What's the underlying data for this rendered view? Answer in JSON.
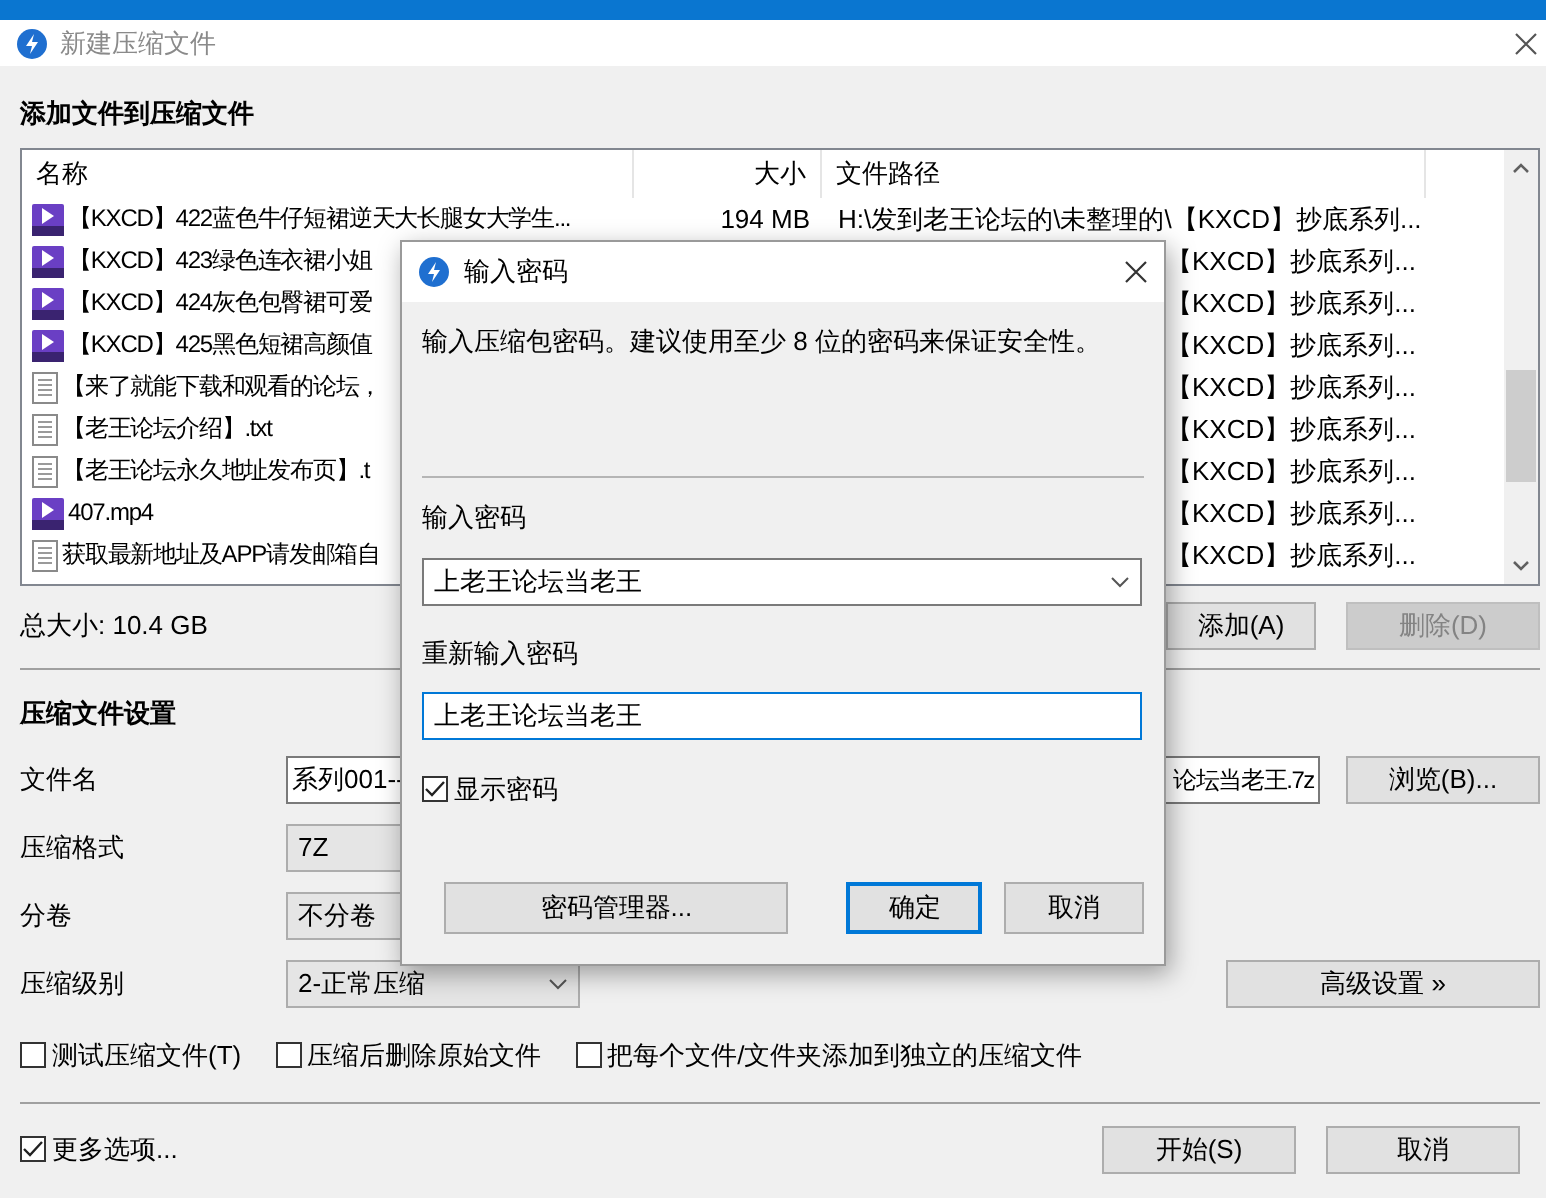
{
  "window": {
    "title": "新建压缩文件"
  },
  "files_section": {
    "heading": "添加文件到压缩文件",
    "columns": [
      "名称",
      "大小",
      "文件路径"
    ],
    "rows": [
      {
        "kind": "video",
        "name": "【KXCD】422蓝色牛仔短裙逆天大长腿女大学生...",
        "size": "194 MB",
        "path": "H:\\发到老王论坛的\\未整理的\\【KXCD】抄底系列..."
      },
      {
        "kind": "video",
        "name": "【KXCD】423绿色连衣裙小姐",
        "path": "【KXCD】抄底系列..."
      },
      {
        "kind": "video",
        "name": "【KXCD】424灰色包臀裙可爱",
        "path": "【KXCD】抄底系列..."
      },
      {
        "kind": "video",
        "name": "【KXCD】425黑色短裙高颜值",
        "path": "【KXCD】抄底系列..."
      },
      {
        "kind": "text",
        "name": "【来了就能下载和观看的论坛，",
        "path": "【KXCD】抄底系列..."
      },
      {
        "kind": "text",
        "name": "【老王论坛介绍】.txt",
        "path": "【KXCD】抄底系列..."
      },
      {
        "kind": "text",
        "name": "【老王论坛永久地址发布页】.t",
        "path": "【KXCD】抄底系列..."
      },
      {
        "kind": "video",
        "name": "407.mp4",
        "path": "【KXCD】抄底系列..."
      },
      {
        "kind": "text",
        "name": "获取最新地址及APP请发邮箱自",
        "path": "【KXCD】抄底系列..."
      }
    ],
    "total_size": "总大小: 10.4 GB",
    "buttons": [
      {
        "label": "添加(A)",
        "disabled": false
      },
      {
        "label": "删除(D)",
        "disabled": true
      }
    ]
  },
  "settings": {
    "heading": "压缩文件设置",
    "fields": [
      {
        "kind": "text",
        "label": "文件名",
        "value_start": "系列001--",
        "value_end": "论坛当老王.7z",
        "button": "浏览(B)..."
      },
      {
        "kind": "combo",
        "label": "压缩格式",
        "value": "7Z"
      },
      {
        "kind": "combo",
        "label": "分卷",
        "value": "不分卷"
      },
      {
        "kind": "combo",
        "label": "压缩级别",
        "value": "2-正常压缩",
        "button": "高级设置 »"
      }
    ],
    "options": [
      {
        "label": "测试压缩文件(T)",
        "checked": false
      },
      {
        "label": "压缩后删除原始文件",
        "checked": false
      },
      {
        "label": "把每个文件/文件夹添加到独立的压缩文件",
        "checked": false
      }
    ],
    "more_options": {
      "label": "更多选项...",
      "checked": true
    },
    "buttons": [
      "开始(S)",
      "取消"
    ]
  },
  "password_dialog": {
    "title": "输入密码",
    "message": "输入压缩包密码。建议使用至少 8 位的密码来保证安全性。",
    "password_label": "输入密码",
    "password": "上老王论坛当老王",
    "confirm_label": "重新输入密码",
    "confirm": "上老王论坛当老王",
    "show_password": {
      "label": "显示密码",
      "checked": true
    },
    "buttons": [
      {
        "label": "密码管理器...",
        "default": false
      },
      {
        "label": "确定",
        "default": true
      },
      {
        "label": "取消",
        "default": false
      }
    ]
  }
}
